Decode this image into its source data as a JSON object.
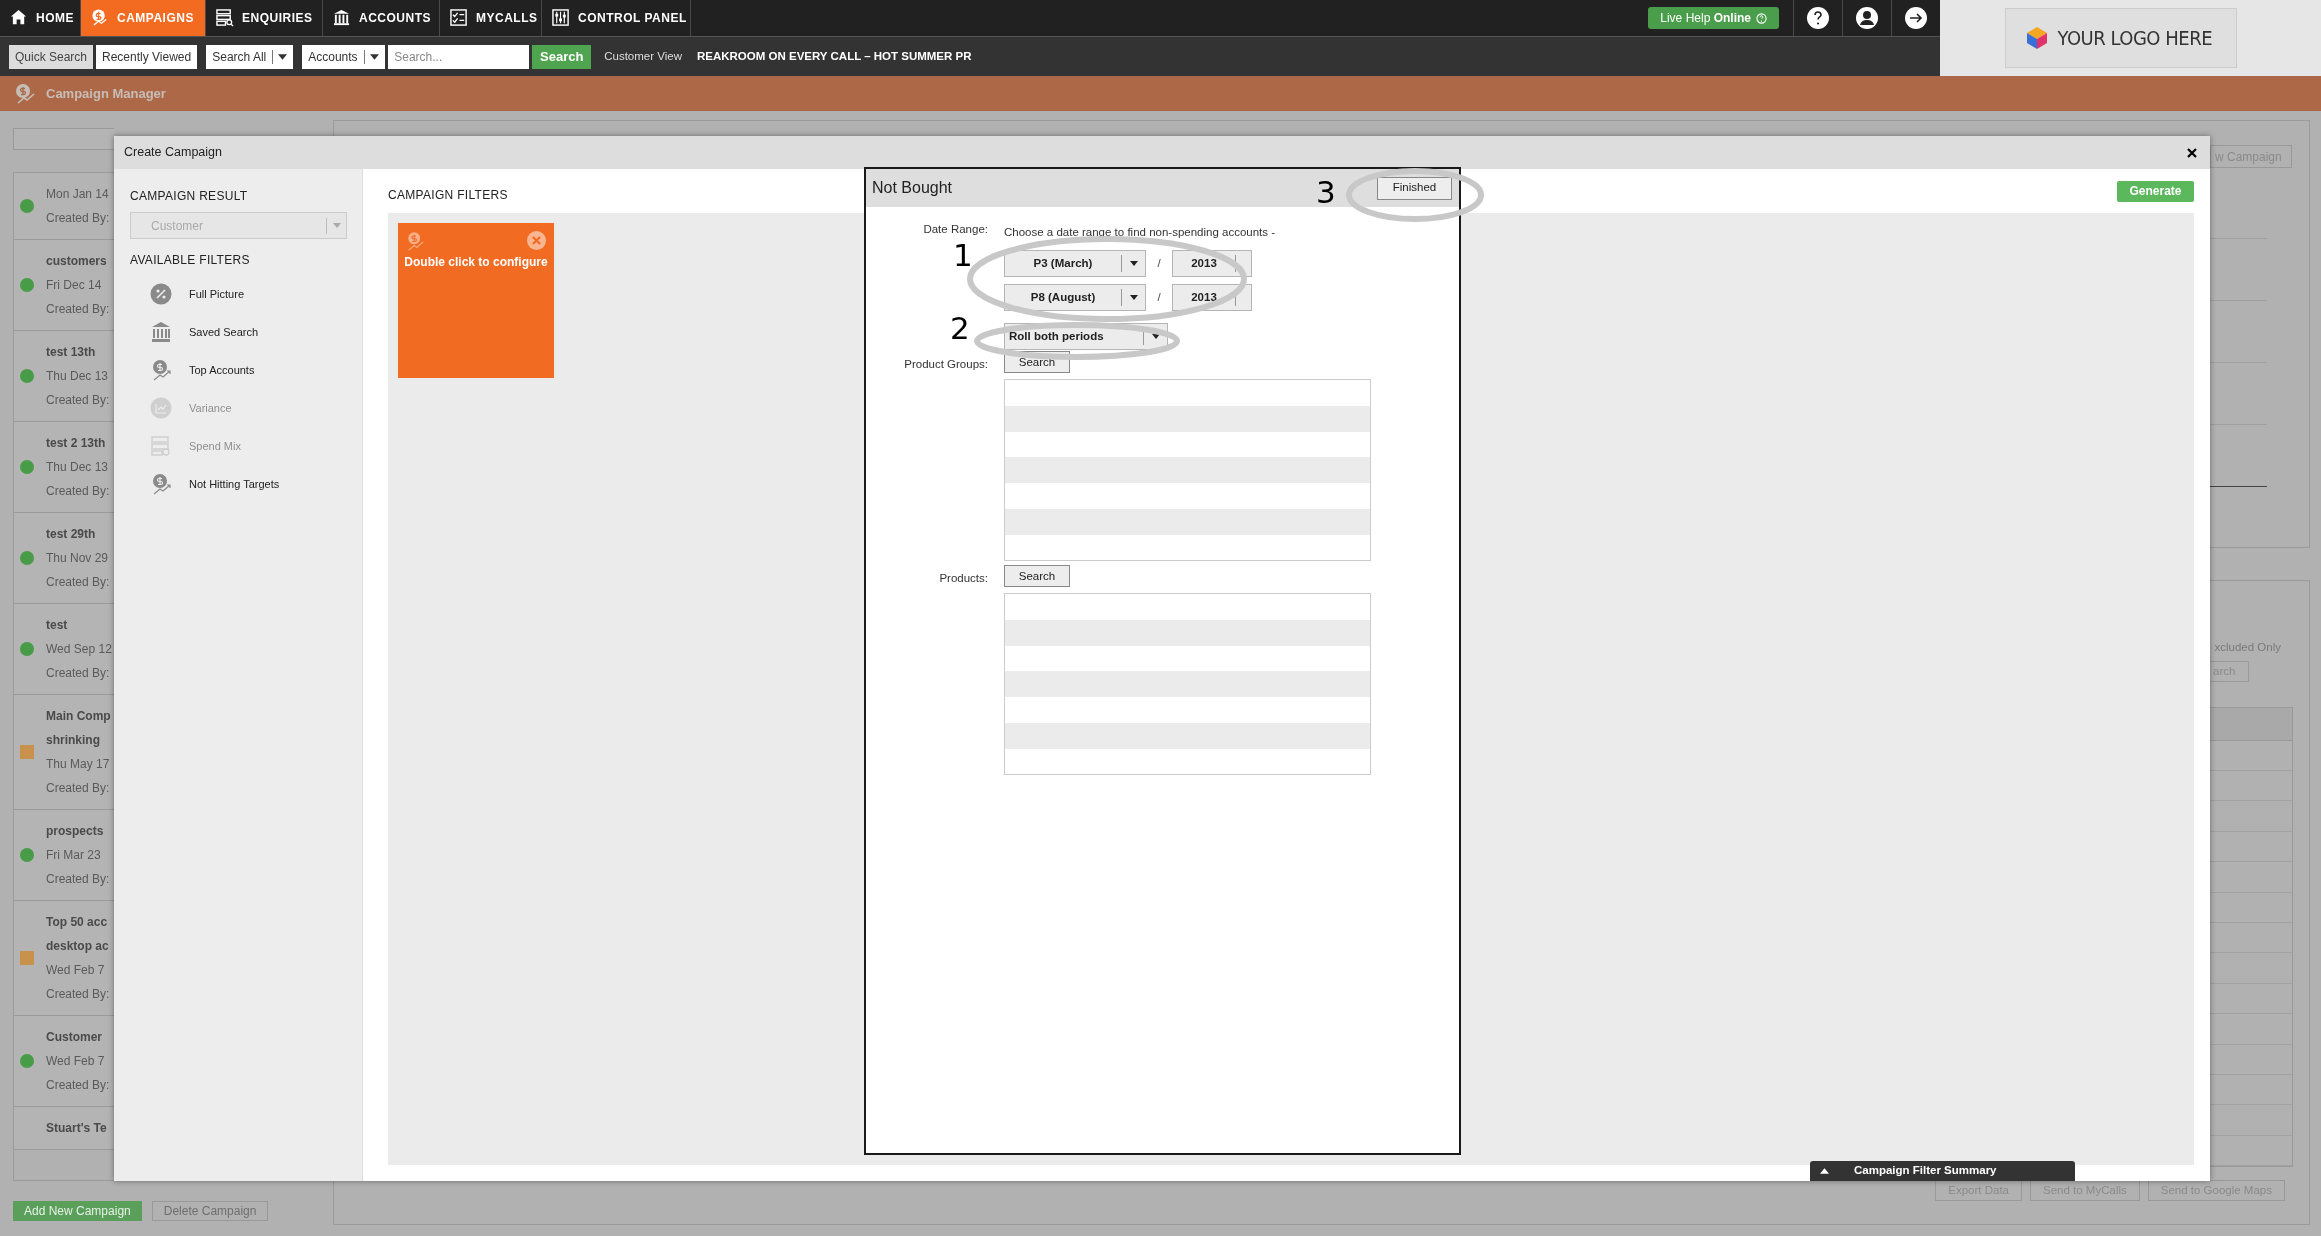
{
  "nav": {
    "items": [
      {
        "label": "HOME",
        "selected": false
      },
      {
        "label": "CAMPAIGNS",
        "selected": true
      },
      {
        "label": "ENQUIRIES",
        "selected": false
      },
      {
        "label": "ACCOUNTS",
        "selected": false
      },
      {
        "label": "MYCALLS",
        "selected": false
      },
      {
        "label": "CONTROL PANEL",
        "selected": false
      }
    ],
    "live_help": "Live Help **Online**"
  },
  "logo": "YOUR LOGO HERE",
  "toolbar": {
    "tabs": [
      {
        "label": "Quick Search",
        "selected": true
      },
      {
        "label": "Recently Viewed",
        "selected": false
      }
    ],
    "scope": "Search All",
    "entity": "Accounts",
    "search_placeholder": "Search...",
    "search_button": "Search",
    "view_label": "Customer View",
    "view_title": "REAKROOM ON EVERY CALL – HOT SUMMER PR"
  },
  "page_title": "Campaign Manager",
  "campaigns": [
    {
      "date": "Mon Jan 14",
      "created": "Created By:",
      "kind": "dot",
      "color": "#489c48"
    },
    {
      "title_lines": [
        "customers"
      ],
      "date": "Fri Dec 14",
      "created": "Created By:",
      "kind": "dot",
      "color": "#489c48"
    },
    {
      "title_lines": [
        "test 13th"
      ],
      "date": "Thu Dec 13",
      "created": "Created By:",
      "kind": "dot",
      "color": "#489c48"
    },
    {
      "title_lines": [
        "test 2 13th"
      ],
      "date": "Thu Dec 13",
      "created": "Created By:",
      "kind": "dot",
      "color": "#489c48"
    },
    {
      "title_lines": [
        "test 29th"
      ],
      "date": "Thu Nov 29",
      "created": "Created By:",
      "kind": "dot",
      "color": "#489c48"
    },
    {
      "title_lines": [
        "test"
      ],
      "date": "Wed Sep 12",
      "created": "Created By:",
      "kind": "dot",
      "color": "#489c48"
    },
    {
      "title_lines": [
        "Main Comp",
        "shrinking"
      ],
      "date": "Thu May 17",
      "created": "Created By:",
      "kind": "square",
      "color": "#c8914c"
    },
    {
      "title_lines": [
        "prospects"
      ],
      "date": "Fri Mar 23",
      "created": "Created By:",
      "kind": "dot",
      "color": "#489c48"
    },
    {
      "title_lines": [
        "Top 50 acc",
        "desktop ac"
      ],
      "date": "Wed Feb 7",
      "created": "Created By:",
      "kind": "square",
      "color": "#c8914c"
    },
    {
      "title_lines": [
        "Customer"
      ],
      "date": "Wed Feb 7",
      "created": "Created By:",
      "kind": "dot",
      "color": "#489c48"
    },
    {
      "title_lines": [
        "Stuart's Te"
      ]
    }
  ],
  "campaign_buttons": [
    {
      "label": "Add New Campaign",
      "disabled": false
    },
    {
      "label": "Delete Campaign",
      "disabled": true
    }
  ],
  "right_panel": {
    "new_button": "w Campaign",
    "filter_text": "xcluded Only",
    "search_button": "arch",
    "export_buttons": [
      "Export Data",
      "Send to MyCalls",
      "Send to Google Maps"
    ]
  },
  "modal": {
    "title": "Create Campaign",
    "result_heading": "CAMPAIGN RESULT",
    "result_select": {
      "value": "Customer",
      "disabled": true
    },
    "filters_heading": "AVAILABLE FILTERS",
    "filters": [
      {
        "label": "Full Picture",
        "disabled": false
      },
      {
        "label": "Saved Search",
        "disabled": false
      },
      {
        "label": "Top Accounts",
        "disabled": false
      },
      {
        "label": "Variance",
        "disabled": true
      },
      {
        "label": "Spend Mix",
        "disabled": true
      },
      {
        "label": "Not Hitting Targets",
        "disabled": false
      }
    ],
    "campaign_filters_heading": "CAMPAIGN FILTERS",
    "generate": "Generate",
    "cards": [
      {
        "text": "Double click to configure"
      }
    ],
    "summary_tab": "Campaign Filter Summary"
  },
  "filter_dialog": {
    "title": "Not Bought",
    "finish": "Finished",
    "date_label": "Date Range:",
    "date_hint": "Choose a date range to find non-spending accounts -",
    "periods": [
      {
        "period": "P3 (March)",
        "separator": "/",
        "year": "2013"
      },
      {
        "period": "P8 (August)",
        "separator": "/",
        "year": "2013"
      }
    ],
    "roll": "Roll both periods",
    "groups_label": "Product Groups:",
    "groups_button": "Search",
    "products_label": "Products:",
    "products_button": "Search"
  },
  "annotations": [
    {
      "number": "1"
    },
    {
      "number": "2"
    },
    {
      "number": "3"
    }
  ]
}
